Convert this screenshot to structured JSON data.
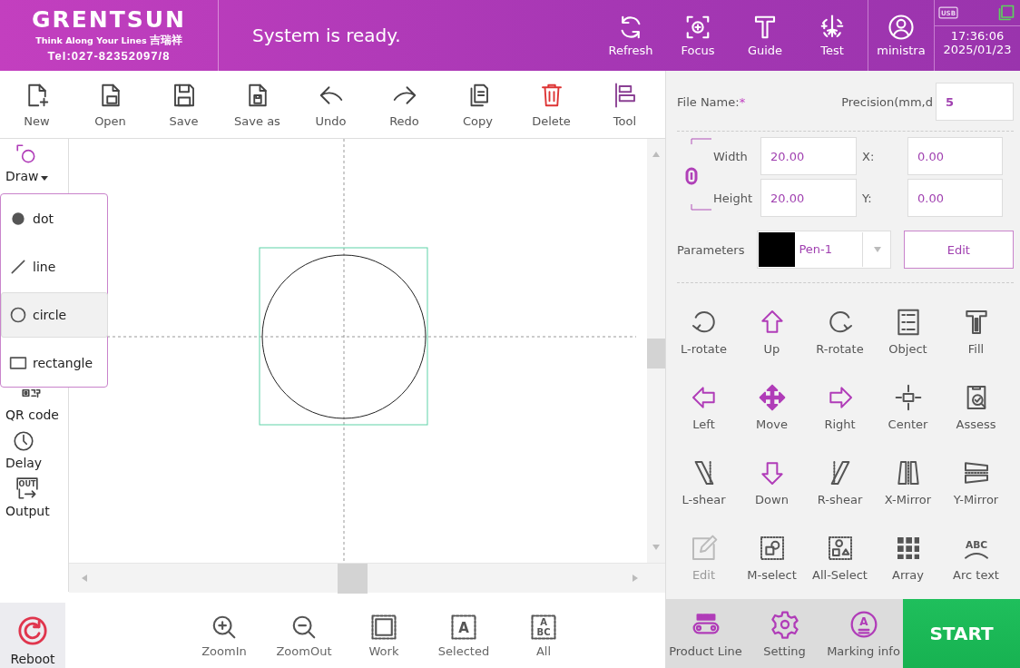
{
  "header": {
    "brand": "GRENTSUN",
    "slogan": "Think Along Your Lines",
    "slogan_cn": "吉瑞祥",
    "tel": "Tel:027-82352097/8",
    "status": "System is ready.",
    "actions": [
      {
        "label": "Refresh",
        "kind": "refresh"
      },
      {
        "label": "Focus",
        "kind": "focus"
      },
      {
        "label": "Guide",
        "kind": "guide"
      },
      {
        "label": "Test",
        "kind": "test"
      }
    ],
    "user": {
      "label": "ministra",
      "kind": "user"
    },
    "indicators": [
      {
        "kind": "usb",
        "glyph": [
          "USB"
        ]
      },
      {
        "kind": "network"
      }
    ],
    "time": "17:36:06",
    "date": "2025/01/23"
  },
  "toolbar": [
    {
      "label": "New",
      "kind": "new"
    },
    {
      "label": "Open",
      "kind": "open"
    },
    {
      "label": "Save",
      "kind": "save"
    },
    {
      "label": "Save as",
      "kind": "saveas"
    },
    {
      "label": "Undo",
      "kind": "undo"
    },
    {
      "label": "Redo",
      "kind": "redo"
    },
    {
      "label": "Copy",
      "kind": "copy"
    },
    {
      "label": "Delete",
      "kind": "delete"
    },
    {
      "label": "Tool",
      "kind": "tool"
    }
  ],
  "draw_menu": {
    "label": "Draw",
    "kind": "draw",
    "expanded": true,
    "items": [
      {
        "label": "dot",
        "kind": "dot",
        "selected": false
      },
      {
        "label": "line",
        "kind": "line",
        "selected": false
      },
      {
        "label": "circle",
        "kind": "circle",
        "selected": true
      },
      {
        "label": "rectangle",
        "kind": "rectangle",
        "selected": false
      }
    ]
  },
  "side_tools": [
    {
      "label": "QR code",
      "kind": "qr"
    },
    {
      "label": "Delay",
      "kind": "clock"
    },
    {
      "label": "Output",
      "kind": "output",
      "glyph": [
        "OUT"
      ]
    }
  ],
  "reboot": {
    "label": "Reboot",
    "kind": "reboot"
  },
  "zoom_bar": [
    {
      "label": "ZoomIn",
      "kind": "zoomin"
    },
    {
      "label": "ZoomOut",
      "kind": "zoomout"
    },
    {
      "label": "Work",
      "kind": "work"
    },
    {
      "label": "Selected",
      "kind": "selected",
      "glyph": [
        "A"
      ]
    },
    {
      "label": "All",
      "kind": "all",
      "glyph": [
        "A",
        "BC"
      ]
    }
  ],
  "properties": {
    "file_name_label": "File Name:",
    "file_name_mark": "*",
    "precision_label": "Precision(mm,d",
    "precision_value": "5",
    "width_label": "Width",
    "width_value": "20.00",
    "height_label": "Height",
    "height_value": "20.00",
    "x_label": "X:",
    "x_value": "0.00",
    "y_label": "Y:",
    "y_value": "0.00",
    "parameters_label": "Parameters",
    "pen_value": "Pen-1",
    "edit_label": "Edit"
  },
  "tools": [
    {
      "label": "L-rotate",
      "kind": "lrotate",
      "disabled": false
    },
    {
      "label": "Up",
      "kind": "up",
      "disabled": false
    },
    {
      "label": "R-rotate",
      "kind": "rrotate",
      "disabled": false
    },
    {
      "label": "Object",
      "kind": "object",
      "disabled": false
    },
    {
      "label": "Fill",
      "kind": "fill",
      "disabled": false
    },
    {
      "label": "Left",
      "kind": "left",
      "disabled": false
    },
    {
      "label": "Move",
      "kind": "move",
      "disabled": false
    },
    {
      "label": "Right",
      "kind": "right",
      "disabled": false
    },
    {
      "label": "Center",
      "kind": "center",
      "disabled": false
    },
    {
      "label": "Assess",
      "kind": "assess",
      "disabled": false
    },
    {
      "label": "L-shear",
      "kind": "lshear",
      "disabled": false
    },
    {
      "label": "Down",
      "kind": "down",
      "disabled": false
    },
    {
      "label": "R-shear",
      "kind": "rshear",
      "disabled": false
    },
    {
      "label": "X-Mirror",
      "kind": "xmirror",
      "disabled": false
    },
    {
      "label": "Y-Mirror",
      "kind": "ymirror",
      "disabled": false
    },
    {
      "label": "Edit",
      "kind": "edit",
      "disabled": true
    },
    {
      "label": "M-select",
      "kind": "mselect",
      "disabled": false
    },
    {
      "label": "All-Select",
      "kind": "allselect",
      "disabled": false
    },
    {
      "label": "Array",
      "kind": "array",
      "disabled": false
    },
    {
      "label": "Arc text",
      "kind": "arc",
      "glyph": [
        "ABC"
      ],
      "disabled": false
    }
  ],
  "bottom_nav": [
    {
      "label": "Product Line",
      "kind": "conveyor"
    },
    {
      "label": "Setting",
      "kind": "gear"
    },
    {
      "label": "Marking info",
      "kind": "marking",
      "glyph": [
        "A"
      ]
    }
  ],
  "start": "START"
}
